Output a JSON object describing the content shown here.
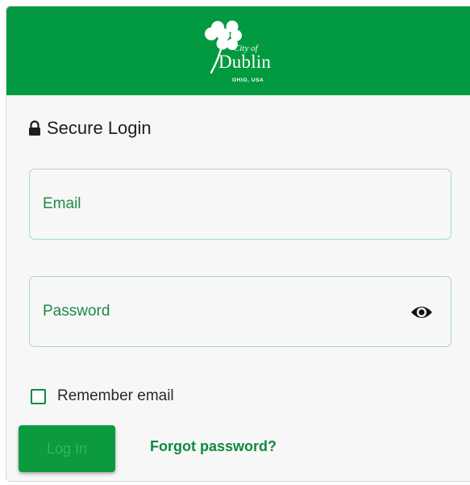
{
  "header": {
    "logo": {
      "icon": "shamrock-icon",
      "small_text": "City of",
      "name": "Dublin",
      "subtext": "OHIO, USA"
    }
  },
  "login": {
    "title": "Secure Login",
    "title_icon": "lock-icon",
    "email": {
      "placeholder": "Email",
      "value": ""
    },
    "password": {
      "placeholder": "Password",
      "value": "",
      "toggle_icon": "eye-icon"
    },
    "remember_label": "Remember email",
    "remember_checked": false,
    "login_label": "Log In",
    "forgot_label": "Forgot password?"
  },
  "colors": {
    "brand_green": "#029a40",
    "link_green": "#0f8a40",
    "field_border": "#a8dbb6"
  }
}
